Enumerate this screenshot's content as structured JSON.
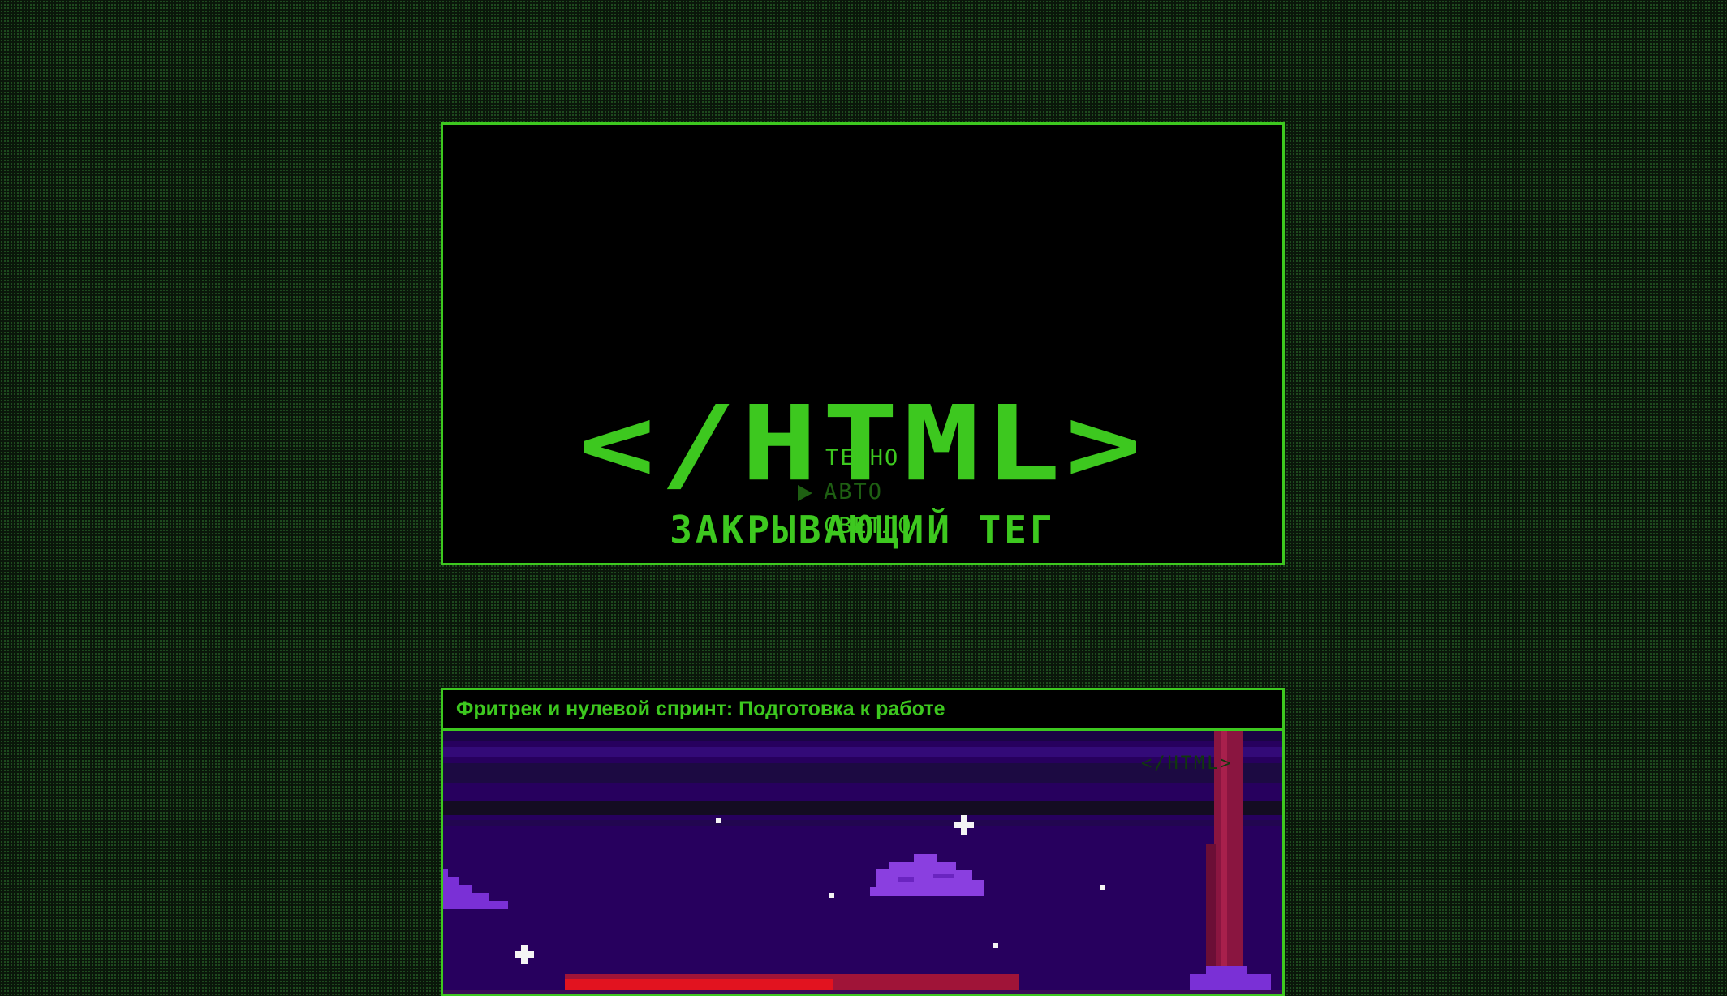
{
  "hero": {
    "logo": "</HTML>",
    "subtitle": "ЗАКРЫВАЮЩИЙ ТЕГ",
    "theme_menu": {
      "items": [
        "ТЕМНО",
        "АВТО",
        "СВЕТЛО"
      ],
      "selected": "АВТО"
    },
    "accent_color": "#3dc81f",
    "selected_color": "#1e5f12"
  },
  "article": {
    "title": "Фритрек и нулевой спринт: Подготовка к работе",
    "cover_logo": "</HTML>"
  }
}
